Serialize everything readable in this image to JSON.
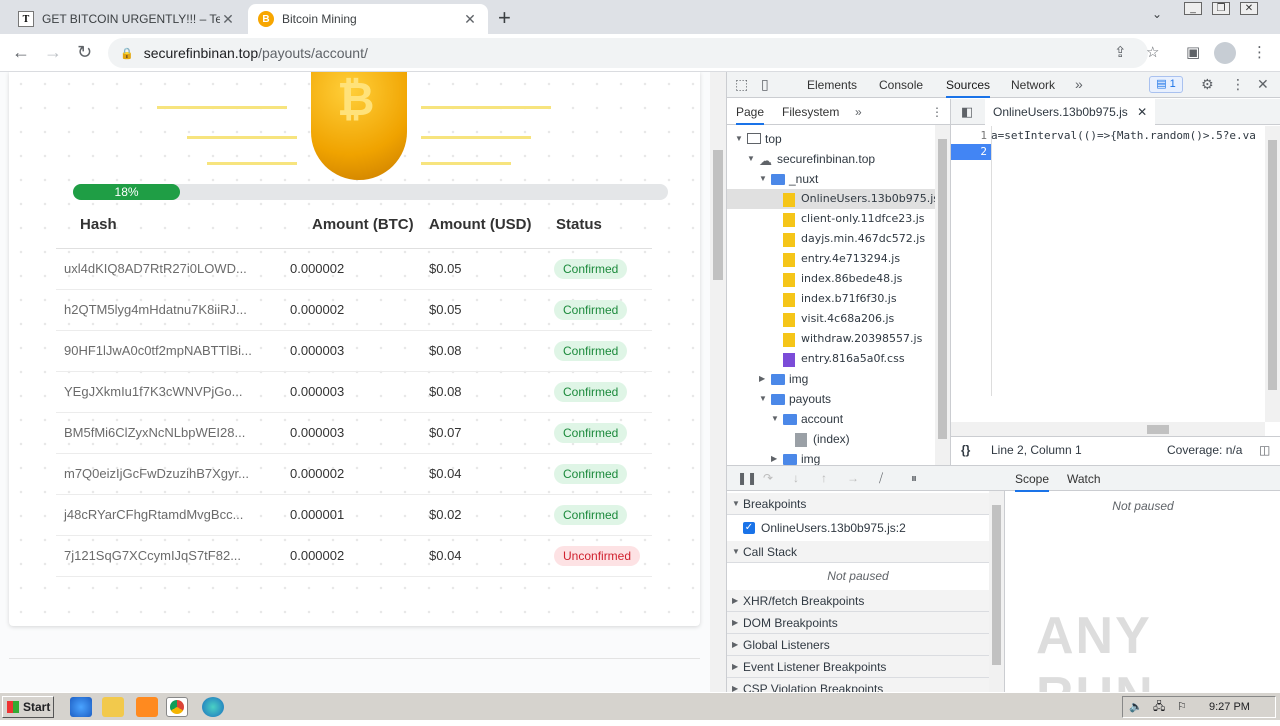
{
  "browser": {
    "tabs": [
      {
        "title": "GET BITCOIN URGENTLY!!! – Telegra",
        "favicon": "T"
      },
      {
        "title": "Bitcoin Mining",
        "favicon": "B"
      }
    ],
    "url_host": "securefinbinan.top",
    "url_path": "/payouts/account/"
  },
  "page": {
    "progress_label": "18%",
    "progress_value": 0.18,
    "table": {
      "headers": [
        "Hash",
        "Amount (BTC)",
        "Amount (USD)",
        "Status"
      ],
      "rows": [
        {
          "hash": "uxl4dKIQ8AD7RtR27i0LOWD...",
          "btc": "0.000002",
          "usd": "$0.05",
          "status": "Confirmed"
        },
        {
          "hash": "h2QTM5lyg4mHdatnu7K8iiRJ...",
          "btc": "0.000002",
          "usd": "$0.05",
          "status": "Confirmed"
        },
        {
          "hash": "90HF1lJwA0c0tf2mpNABTTlBi...",
          "btc": "0.000003",
          "usd": "$0.08",
          "status": "Confirmed"
        },
        {
          "hash": "YEgJXkmIu1f7K3cWNVPjGo...",
          "btc": "0.000003",
          "usd": "$0.08",
          "status": "Confirmed"
        },
        {
          "hash": "BM5fMi6ClZyxNcNLbpWEI28...",
          "btc": "0.000003",
          "usd": "$0.07",
          "status": "Confirmed"
        },
        {
          "hash": "m7Q0eizIjGcFwDzuzihB7Xgyr...",
          "btc": "0.000002",
          "usd": "$0.04",
          "status": "Confirmed"
        },
        {
          "hash": "j48cRYarCFhgRtamdMvgBcc...",
          "btc": "0.000001",
          "usd": "$0.02",
          "status": "Confirmed"
        },
        {
          "hash": "7j121SqG7XCcymIJqS7tF82...",
          "btc": "0.000002",
          "usd": "$0.04",
          "status": "Unconfirmed"
        }
      ]
    }
  },
  "devtools": {
    "tabs": [
      "Elements",
      "Console",
      "Sources",
      "Network"
    ],
    "selected_tab": "Sources",
    "issues_count": "1",
    "nav_tabs": [
      "Page",
      "Filesystem"
    ],
    "tree": [
      {
        "label": "top",
        "kind": "frame",
        "depth": 0,
        "open": true
      },
      {
        "label": "securefinbinan.top",
        "kind": "cloud",
        "depth": 1,
        "open": true
      },
      {
        "label": "_nuxt",
        "kind": "folder",
        "depth": 2,
        "open": true
      },
      {
        "label": "OnlineUsers.13b0b975.js",
        "kind": "js",
        "depth": 3,
        "selected": true
      },
      {
        "label": "client-only.11dfce23.js",
        "kind": "js",
        "depth": 3
      },
      {
        "label": "dayjs.min.467dc572.js",
        "kind": "js",
        "depth": 3
      },
      {
        "label": "entry.4e713294.js",
        "kind": "js",
        "depth": 3
      },
      {
        "label": "index.86bede48.js",
        "kind": "js",
        "depth": 3
      },
      {
        "label": "index.b71f6f30.js",
        "kind": "js",
        "depth": 3
      },
      {
        "label": "visit.4c68a206.js",
        "kind": "js",
        "depth": 3
      },
      {
        "label": "withdraw.20398557.js",
        "kind": "js",
        "depth": 3
      },
      {
        "label": "entry.816a5a0f.css",
        "kind": "css",
        "depth": 3
      },
      {
        "label": "img",
        "kind": "folder",
        "depth": 2,
        "open": false
      },
      {
        "label": "payouts",
        "kind": "folder",
        "depth": 2,
        "open": true
      },
      {
        "label": "account",
        "kind": "folder",
        "depth": 3,
        "open": true
      },
      {
        "label": "(index)",
        "kind": "doc",
        "depth": 4
      },
      {
        "label": "img",
        "kind": "folder",
        "depth": 3,
        "open": false
      }
    ],
    "editor_file": "OnlineUsers.13b0b975.js",
    "code_lines": [
      "a=setInterval(()=>{Math.random()>.5?e.va",
      ""
    ],
    "status_position": "Line 2, Column 1",
    "coverage": "Coverage: n/a",
    "sections": {
      "breakpoints": "Breakpoints",
      "breakpoint_item": "OnlineUsers.13b0b975.js:2",
      "call_stack": "Call Stack",
      "not_paused": "Not paused",
      "collapsed": [
        "XHR/fetch Breakpoints",
        "DOM Breakpoints",
        "Global Listeners",
        "Event Listener Breakpoints",
        "CSP Violation Breakpoints"
      ]
    },
    "scope_tabs": [
      "Scope",
      "Watch"
    ]
  },
  "taskbar": {
    "start": "Start",
    "clock": "9:27 PM"
  },
  "watermark": "ANY RUN",
  "colors": {
    "progress": "#1f9e45",
    "confirmed_bg": "#dff5e6",
    "unconfirmed_bg": "#fde2e4",
    "devtools_accent": "#1a73e8"
  }
}
